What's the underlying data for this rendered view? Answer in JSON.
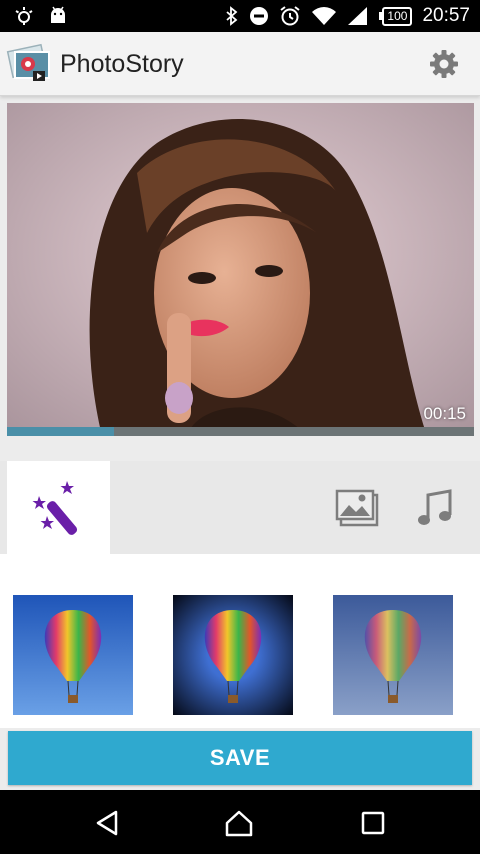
{
  "status_bar": {
    "time": "20:57",
    "battery": "100",
    "icons": [
      "brightness-icon",
      "android-icon",
      "bluetooth-icon",
      "do-not-disturb-icon",
      "alarm-icon",
      "wifi-icon",
      "signal-icon",
      "battery-icon"
    ]
  },
  "app_bar": {
    "title": "PhotoStory",
    "logo_icon": "photostory-logo-icon",
    "settings_icon": "gear-icon"
  },
  "preview": {
    "duration": "00:15",
    "progress": 0.23
  },
  "tabs": [
    {
      "name": "effects",
      "icon": "magic-wand-icon",
      "selected": true
    },
    {
      "name": "photos",
      "icon": "gallery-icon",
      "selected": false
    },
    {
      "name": "music",
      "icon": "music-note-icon",
      "selected": false
    }
  ],
  "effects": [
    {
      "name": "balloon-effect-normal"
    },
    {
      "name": "balloon-effect-vignette"
    },
    {
      "name": "balloon-effect-faded"
    }
  ],
  "save_label": "SAVE",
  "colors": {
    "accent": "#2fa9cf",
    "progress": "#4a8fa8",
    "wand": "#6a1fa8"
  }
}
